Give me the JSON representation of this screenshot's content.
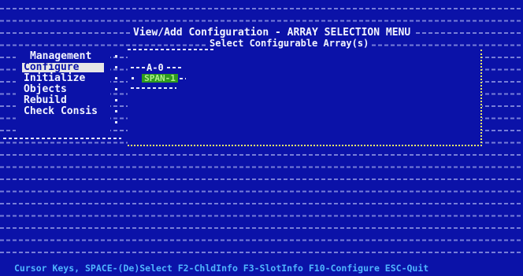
{
  "header": {
    "title": "View/Add Configuration - ARRAY SELECTION MENU",
    "subtitle": "Select Configurable Array(s)"
  },
  "menu": {
    "items": [
      {
        "label": "Management"
      },
      {
        "label": "Configure"
      },
      {
        "label": "Initialize"
      },
      {
        "label": "Objects"
      },
      {
        "label": "Rebuild"
      },
      {
        "label": "Check Consis"
      }
    ],
    "selected_index": 1
  },
  "arrays": [
    {
      "label": "A-0",
      "status": "SPAN-1"
    }
  ],
  "footer": {
    "help_text": "Cursor Keys, SPACE-(De)Select F2-ChldInfo F3-SlotInfo F10-Configure ESC-Quit"
  },
  "colors": {
    "background": "#0b12a8",
    "text": "#f2f4ff",
    "selection_bg": "#e6e6e6",
    "array_badge": "#2e9a1e",
    "footer_text": "#4fb5ff",
    "box_border": "#e8e86a"
  }
}
